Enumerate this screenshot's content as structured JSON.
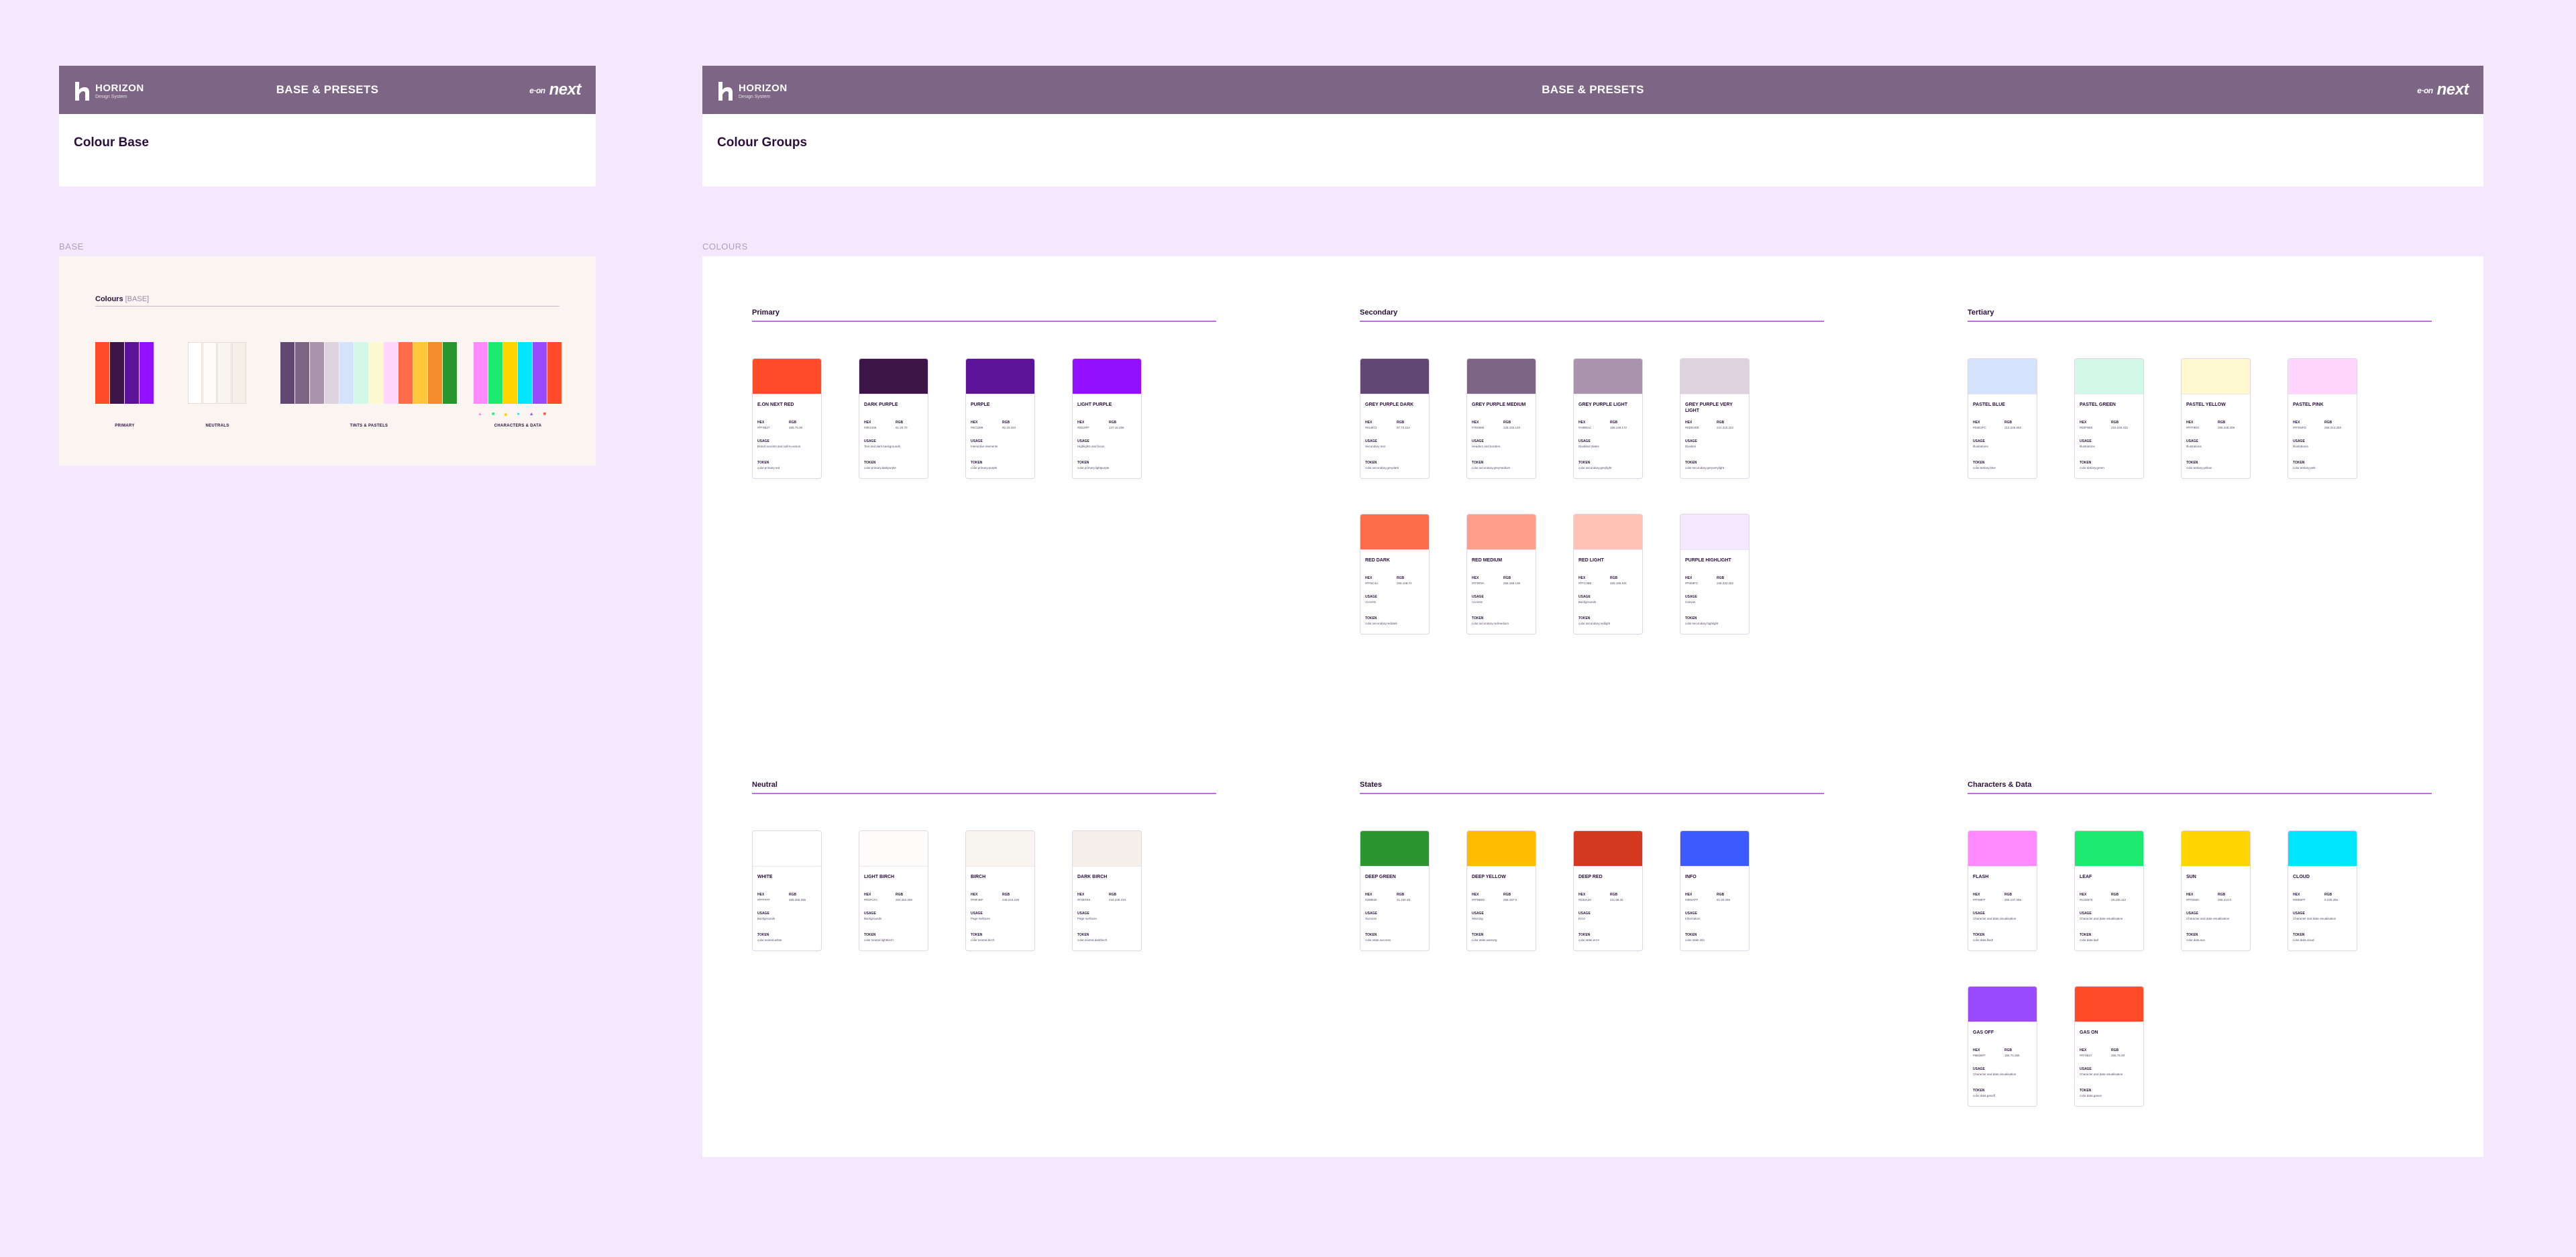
{
  "header": {
    "logo_text": "HORIZON",
    "logo_sub": "Design System",
    "title": "BASE & PRESETS",
    "brand_pre": "e·on",
    "brand": "next"
  },
  "frames": {
    "left_title": "Colour Base",
    "right_title": "Colour Groups"
  },
  "sections": {
    "base_label": "BASE",
    "colours_label": "COLOURS"
  },
  "base_panel": {
    "heading": "Colours",
    "heading_sub": "[BASE]",
    "group_labels": [
      "PRIMARY",
      "NEUTRALS",
      "TINTS & PASTELS",
      "CHARACTERS & DATA"
    ],
    "primary": [
      "#ff4b27",
      "#3d1446",
      "#5c1399",
      "#9310ff"
    ],
    "neutrals": [
      "#ffffff",
      "#fdfcfa",
      "#f8f4ef",
      "#f4efe9"
    ],
    "tints": [
      "#614872",
      "#7d6685",
      "#a895ac",
      "#ddd2de",
      "#d4e2fc",
      "#d2f9e8",
      "#fff8d0",
      "#ffd6fd",
      "#ff6c4a",
      "#ffc73a",
      "#f28c2d",
      "#299630"
    ],
    "characters": [
      "#ff89ff",
      "#1ceb70",
      "#ffd500",
      "#00e6ff",
      "#9b4bff",
      "#ff4b27"
    ],
    "dot_labels": [
      "▲",
      "■",
      "◆",
      "●",
      "▲",
      "■"
    ]
  },
  "labels": {
    "hex": "HEX",
    "rgb": "RGB",
    "usage": "USAGE",
    "token": "TOKEN"
  },
  "groups": [
    {
      "title": "Primary",
      "cards": [
        {
          "name": "E.ON NEXT RED",
          "color": "#ff4b27",
          "hex": "#FF4B27",
          "rgb": "255.75.39",
          "usage": "Brand accents and call-to-action",
          "token": "color.primary.red"
        },
        {
          "name": "DARK PURPLE",
          "color": "#3d1446",
          "hex": "#3D1446",
          "rgb": "61.20.70",
          "usage": "Text and dark backgrounds",
          "token": "color.primary.darkpurple"
        },
        {
          "name": "PURPLE",
          "color": "#5c1399",
          "hex": "#5C1399",
          "rgb": "92.19.153",
          "usage": "Interactive elements",
          "token": "color.primary.purple"
        },
        {
          "name": "LIGHT PURPLE",
          "color": "#9310ff",
          "hex": "#9310FF",
          "rgb": "147.16.255",
          "usage": "Highlights and focus",
          "token": "color.primary.lightpurple"
        }
      ]
    },
    {
      "title": "Secondary",
      "cards": [
        {
          "name": "GREY PURPLE DARK",
          "color": "#614872",
          "hex": "#614872",
          "rgb": "97.72.114",
          "usage": "Secondary text",
          "token": "color.secondary.greydark"
        },
        {
          "name": "GREY PURPLE MEDIUM",
          "color": "#7d6685",
          "hex": "#7D6685",
          "rgb": "125.102.133",
          "usage": "Headers and borders",
          "token": "color.secondary.greymedium"
        },
        {
          "name": "GREY PURPLE LIGHT",
          "color": "#a895ac",
          "hex": "#A895AC",
          "rgb": "168.149.172",
          "usage": "Disabled states",
          "token": "color.secondary.greylight"
        },
        {
          "name": "GREY PURPLE VERY LIGHT",
          "color": "#ddd2de",
          "hex": "#DDD2DE",
          "rgb": "221.210.222",
          "usage": "Dividers",
          "token": "color.secondary.greyverylight"
        },
        {
          "name": "RED DARK",
          "color": "#ff6c4a",
          "hex": "#FF6C4A",
          "rgb": "255.108.74",
          "usage": "Accents",
          "token": "color.secondary.reddark"
        },
        {
          "name": "RED MEDIUM",
          "color": "#ff9f8a",
          "hex": "#FF9F8A",
          "rgb": "255.159.138",
          "usage": "Accents",
          "token": "color.secondary.redmedium"
        },
        {
          "name": "RED LIGHT",
          "color": "#ffc3b5",
          "hex": "#FFC3B5",
          "rgb": "255.195.181",
          "usage": "Backgrounds",
          "token": "color.secondary.redlight"
        },
        {
          "name": "PURPLE HIGHLIGHT",
          "color": "#f5e8fc",
          "hex": "#F5E8FC",
          "rgb": "245.232.252",
          "usage": "Canvas",
          "token": "color.secondary.highlight"
        }
      ]
    },
    {
      "title": "Tertiary",
      "cards": [
        {
          "name": "PASTEL BLUE",
          "color": "#d4e2fc",
          "hex": "#D4E2FC",
          "rgb": "212.226.252",
          "usage": "Illustrations",
          "token": "color.tertiary.blue"
        },
        {
          "name": "PASTEL GREEN",
          "color": "#d2f9e8",
          "hex": "#D2F9E8",
          "rgb": "210.249.232",
          "usage": "Illustrations",
          "token": "color.tertiary.green"
        },
        {
          "name": "PASTEL YELLOW",
          "color": "#fff8d0",
          "hex": "#FFF8D0",
          "rgb": "255.248.208",
          "usage": "Illustrations",
          "token": "color.tertiary.yellow"
        },
        {
          "name": "PASTEL PINK",
          "color": "#ffd6fd",
          "hex": "#FFD6FD",
          "rgb": "255.214.253",
          "usage": "Illustrations",
          "token": "color.tertiary.pink"
        }
      ]
    },
    {
      "title": "Neutral",
      "cards": [
        {
          "name": "WHITE",
          "color": "#ffffff",
          "hex": "#FFFFFF",
          "rgb": "255.255.255",
          "usage": "Backgrounds",
          "token": "color.neutral.white"
        },
        {
          "name": "LIGHT BIRCH",
          "color": "#fdfcfa",
          "hex": "#FDFCFA",
          "rgb": "253.252.250",
          "usage": "Backgrounds",
          "token": "color.neutral.lightbirch"
        },
        {
          "name": "BIRCH",
          "color": "#f8f4ef",
          "hex": "#F8F4EF",
          "rgb": "248.244.239",
          "usage": "Page surfaces",
          "token": "color.neutral.birch"
        },
        {
          "name": "DARK BIRCH",
          "color": "#f4efe9",
          "hex": "#F4EFE9",
          "rgb": "244.239.233",
          "usage": "Page surfaces",
          "token": "color.neutral.darkbirch"
        }
      ]
    },
    {
      "title": "States",
      "cards": [
        {
          "name": "DEEP GREEN",
          "color": "#299630",
          "hex": "#299630",
          "rgb": "41.150.48",
          "usage": "Success",
          "token": "color.state.success"
        },
        {
          "name": "DEEP YELLOW",
          "color": "#ffbb00",
          "hex": "#FFBB00",
          "rgb": "255.187.0",
          "usage": "Warning",
          "token": "color.state.warning"
        },
        {
          "name": "DEEP RED",
          "color": "#d33a20",
          "hex": "#D33A20",
          "rgb": "211.58.32",
          "usage": "Error",
          "token": "color.state.error"
        },
        {
          "name": "INFO",
          "color": "#3d5aff",
          "hex": "#3D5AFF",
          "rgb": "61.90.255",
          "usage": "Information",
          "token": "color.state.info"
        }
      ]
    },
    {
      "title": "Characters & Data",
      "cards": [
        {
          "name": "FLASH",
          "color": "#ff89ff",
          "hex": "#FF89FF",
          "rgb": "255.137.255",
          "usage": "Character and data visualisation",
          "token": "color.data.flash"
        },
        {
          "name": "LEAF",
          "color": "#1ceb70",
          "hex": "#1CEB70",
          "rgb": "28.235.112",
          "usage": "Character and data visualisation",
          "token": "color.data.leaf"
        },
        {
          "name": "SUN",
          "color": "#ffd500",
          "hex": "#FFD500",
          "rgb": "255.213.0",
          "usage": "Character and data visualisation",
          "token": "color.data.sun"
        },
        {
          "name": "CLOUD",
          "color": "#00e6ff",
          "hex": "#00E6FF",
          "rgb": "0.230.255",
          "usage": "Character and data visualisation",
          "token": "color.data.cloud"
        },
        {
          "name": "GAS OFF",
          "color": "#9b4bff",
          "hex": "#9B4BFF",
          "rgb": "155.75.255",
          "usage": "Character and data visualisation",
          "token": "color.data.gasoff"
        },
        {
          "name": "GAS ON",
          "color": "#ff4b27",
          "hex": "#FF4B27",
          "rgb": "255.75.39",
          "usage": "Character and data visualisation",
          "token": "color.data.gason"
        }
      ]
    }
  ]
}
